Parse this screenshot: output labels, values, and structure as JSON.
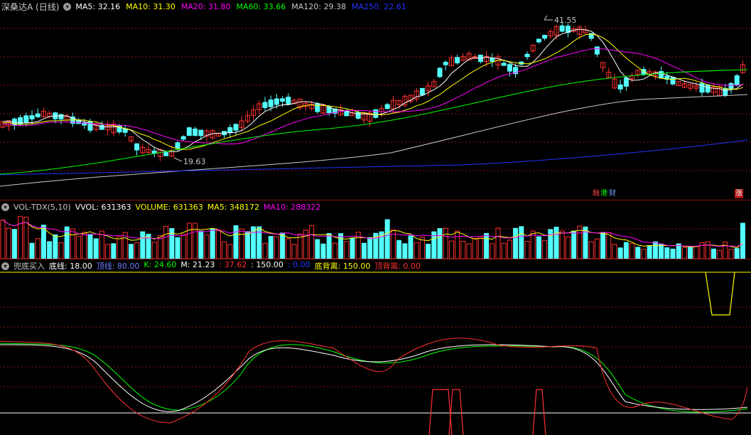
{
  "price": {
    "title": "深桑达A (日线)",
    "ma": [
      {
        "label": "MA5: 32.16",
        "color": "#ffffff"
      },
      {
        "label": "MA10: 31.30",
        "color": "#ffff00"
      },
      {
        "label": "MA20: 31.80",
        "color": "#ff00ff"
      },
      {
        "label": "MA60: 33.66",
        "color": "#00ff00"
      },
      {
        "label": "MA120: 29.38",
        "color": "#c8c8c8"
      },
      {
        "label": "MA250: 22.61",
        "color": "#2233ff"
      }
    ],
    "high_label": "41.55",
    "low_label": "19.63",
    "badges": [
      {
        "text": "融",
        "color": "#ff4040",
        "bg": "#000"
      },
      {
        "text": "港",
        "color": "#00ff00",
        "bg": "#000"
      },
      {
        "text": "财",
        "color": "#6aa0ff",
        "bg": "#000"
      },
      {
        "text": "涨",
        "color": "#ffffff",
        "bg": "#b01010"
      }
    ]
  },
  "volume": {
    "title": "VOL-TDX(5,10)",
    "items": [
      {
        "label": "VVOL: 631363",
        "color": "#ffffff"
      },
      {
        "label": "VOLUME: 631363",
        "color": "#ffff00"
      },
      {
        "label": "MA5: 348172",
        "color": "#ffff00"
      },
      {
        "label": "MA10: 288322",
        "color": "#ff00ff"
      }
    ]
  },
  "indicator": {
    "title": "兜底买入",
    "items": [
      {
        "label": "底线: 18.00",
        "color": "#ffffff"
      },
      {
        "label": "顶线: 80.00",
        "color": "#6a7aff"
      },
      {
        "label": "K: 24.60",
        "color": "#00ff00"
      },
      {
        "label": "M: 21.23",
        "color": "#ffffff"
      },
      {
        "label": ": 37.62",
        "color": "#ff3030"
      },
      {
        "label": ": 150.00",
        "color": "#ffffff"
      },
      {
        "label": ": 0.00",
        "color": "#2233ff"
      },
      {
        "label": "底背离: 150.00",
        "color": "#ffff00"
      },
      {
        "label": "顶背离: 0.00",
        "color": "#ff3030"
      }
    ]
  },
  "colors": {
    "up": "#ff3030",
    "down": "#54ffff",
    "grid": "#8a1010",
    "ma5": "#ffffff",
    "ma10": "#ffff00",
    "ma20": "#ff00ff",
    "ma60": "#00ff00",
    "ma120": "#c8c8c8",
    "ma250": "#2233ff"
  }
}
